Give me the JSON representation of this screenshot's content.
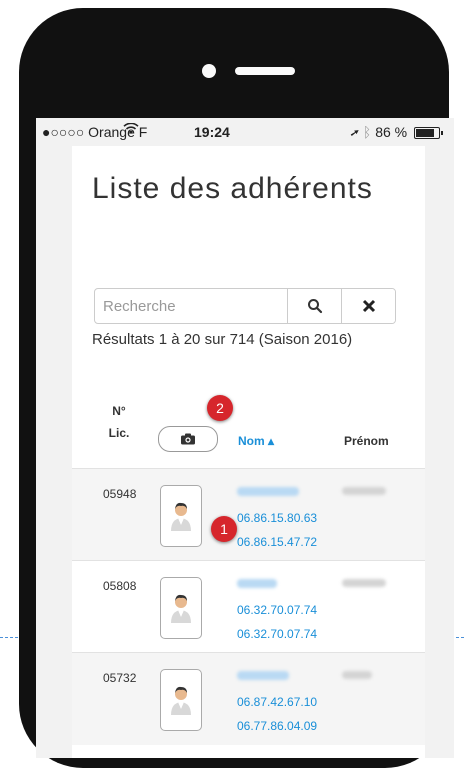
{
  "status_bar": {
    "carrier": "●○○○○ Orange F",
    "time": "19:24",
    "battery": "86 %"
  },
  "page": {
    "title": "Liste des adhérents",
    "search_placeholder": "Recherche",
    "results": "Résultats 1 à 20 sur 714 (Saison 2016)"
  },
  "table": {
    "headers": {
      "lic": "N° Lic.",
      "nom": "Nom ▴",
      "prenom": "Prénom"
    },
    "rows": [
      {
        "lic": "05948",
        "phone1": "06.86.15.80.63",
        "phone2": "06.86.15.47.72"
      },
      {
        "lic": "05808",
        "phone1": "06.32.70.07.74",
        "phone2": "06.32.70.07.74"
      },
      {
        "lic": "05732",
        "phone1": "06.87.42.67.10",
        "phone2": "06.77.86.04.09"
      }
    ]
  },
  "badges": {
    "one": "1",
    "two": "2"
  },
  "colors": {
    "link": "#1a8fd8",
    "badge": "#d6262c",
    "phone_frame": "#111111"
  },
  "icons": [
    "search-icon",
    "close-icon",
    "camera-icon",
    "avatar-icon",
    "wifi-icon",
    "location-icon",
    "bluetooth-icon",
    "battery-icon"
  ]
}
